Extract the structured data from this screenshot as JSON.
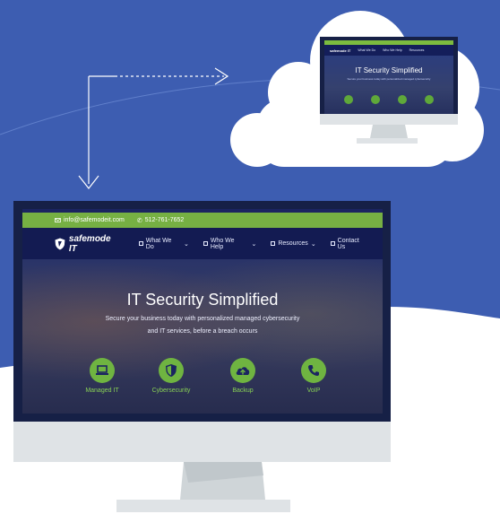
{
  "brand": {
    "logo_text": "safemode IT",
    "colors": {
      "navy": "#131b52",
      "green": "#76b043",
      "blue_bg": "#3e5fb4"
    }
  },
  "topbar": {
    "email": "info@safemodeit.com",
    "phone": "512-761-7652"
  },
  "nav": {
    "items": [
      {
        "label": "What We Do",
        "dropdown": true
      },
      {
        "label": "Who We Help",
        "dropdown": true
      },
      {
        "label": "Resources",
        "dropdown": true
      },
      {
        "label": "Contact Us",
        "dropdown": false
      }
    ]
  },
  "hero": {
    "title": "IT Security Simplified",
    "subtitle_line1": "Secure your business today with personalized managed cybersecurity",
    "subtitle_line2": "and IT services, before a breach occurs"
  },
  "services": [
    {
      "label": "Managed IT",
      "icon": "laptop-icon"
    },
    {
      "label": "Cybersecurity",
      "icon": "shield-icon"
    },
    {
      "label": "Backup",
      "icon": "cloud-upload-icon"
    },
    {
      "label": "VoIP",
      "icon": "phone-icon"
    }
  ]
}
